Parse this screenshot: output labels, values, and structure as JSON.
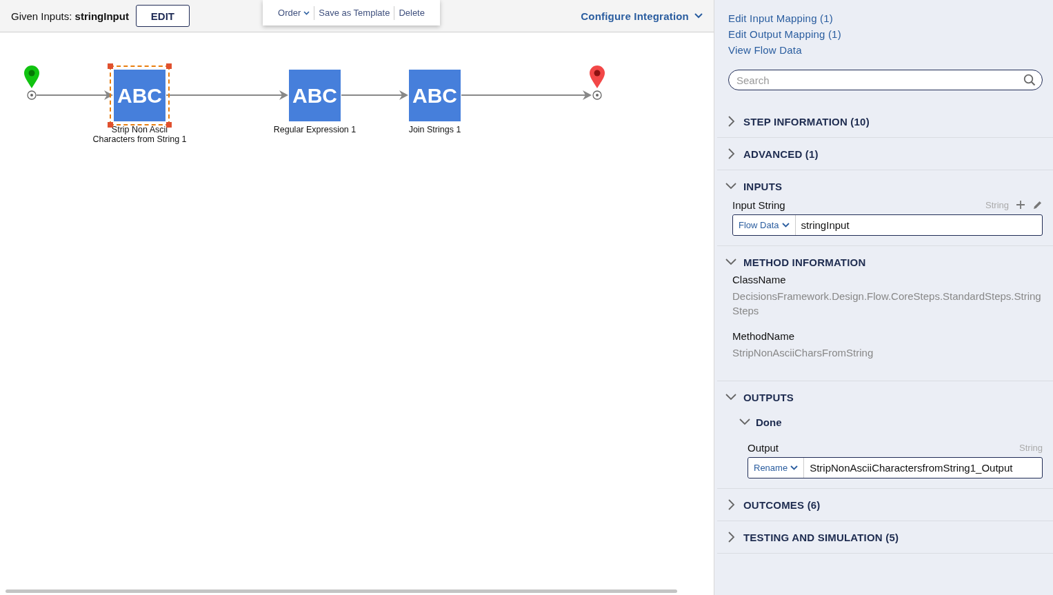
{
  "toolbar": {
    "given_inputs_label": "Given Inputs:",
    "given_inputs_value": "stringInput",
    "edit_button": "EDIT",
    "configure_link": "Configure Integration"
  },
  "context_menu": {
    "items": [
      {
        "label": "Order",
        "kind": "dropdown"
      },
      {
        "label": "Save as Template",
        "kind": "action"
      },
      {
        "label": "Delete",
        "kind": "action"
      }
    ]
  },
  "flow": {
    "steps": [
      {
        "icon_text": "ABC",
        "label": "Strip Non Ascii Characters from String 1",
        "selected": true
      },
      {
        "icon_text": "ABC",
        "label": "Regular Expression 1",
        "selected": false
      },
      {
        "icon_text": "ABC",
        "label": "Join Strings 1",
        "selected": false
      }
    ]
  },
  "panel": {
    "links": [
      "Edit Input Mapping (1)",
      "Edit Output Mapping (1)",
      "View Flow Data"
    ],
    "search": {
      "placeholder": "Search"
    },
    "sections": [
      {
        "title": "STEP INFORMATION (10)",
        "expanded": false
      },
      {
        "title": "ADVANCED (1)",
        "expanded": false
      },
      {
        "title": "INPUTS",
        "expanded": true,
        "kind": "inputs",
        "fields": [
          {
            "label": "Input String",
            "type": "String",
            "mode": "Flow Data",
            "value": "stringInput"
          }
        ]
      },
      {
        "title": "METHOD INFORMATION",
        "expanded": true,
        "kind": "properties",
        "properties": [
          {
            "label": "ClassName",
            "value": "DecisionsFramework.Design.Flow.CoreSteps.StandardSteps.StringSteps"
          },
          {
            "label": "MethodName",
            "value": "StripNonAsciiCharsFromString"
          }
        ]
      },
      {
        "title": "OUTPUTS",
        "expanded": true,
        "kind": "outputs",
        "groups": [
          {
            "title": "Done",
            "expanded": true,
            "fields": [
              {
                "label": "Output",
                "type": "String",
                "mode": "Rename",
                "value": "StripNonAsciiCharactersfromString1_Output"
              }
            ]
          }
        ]
      },
      {
        "title": "OUTCOMES (6)",
        "expanded": false
      },
      {
        "title": "TESTING AND SIMULATION (5)",
        "expanded": false
      }
    ]
  }
}
